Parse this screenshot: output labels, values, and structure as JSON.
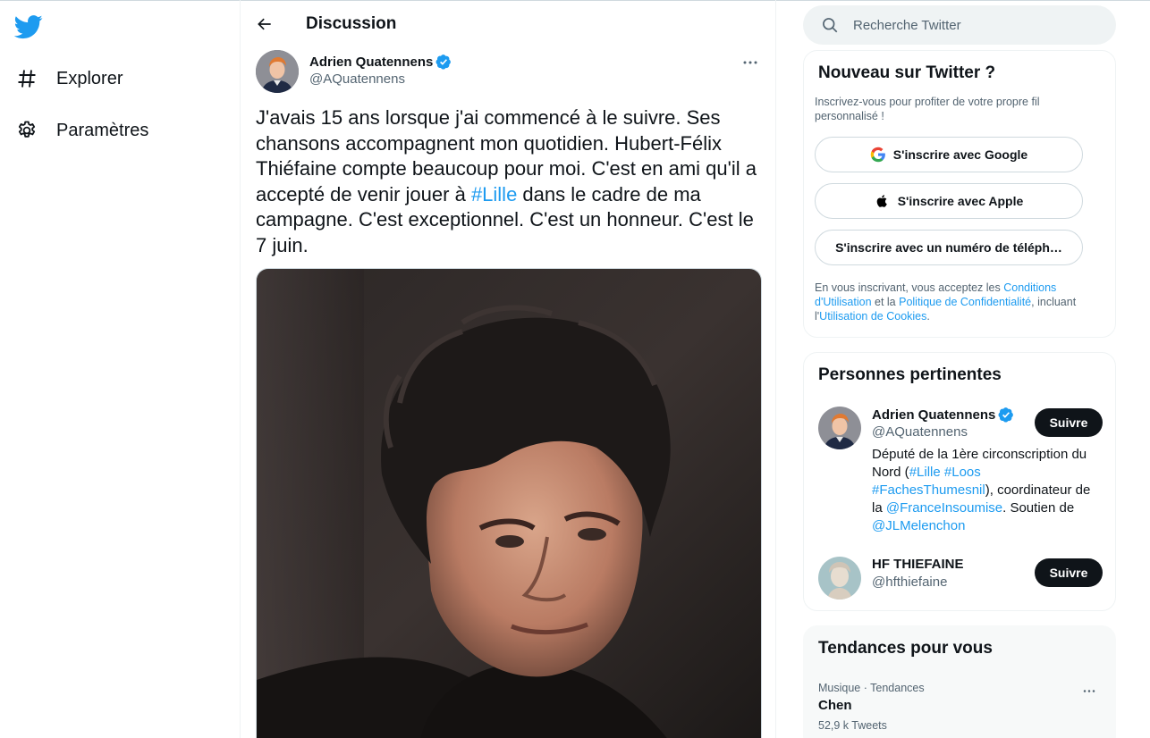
{
  "colors": {
    "brand": "#1d9bf0",
    "text": "#0f1419",
    "muted": "#536471",
    "follow_bg": "#0f1419"
  },
  "nav": {
    "logo_icon": "twitter-bird-icon",
    "items": [
      {
        "label": "Explorer",
        "icon": "hashtag-icon"
      },
      {
        "label": "Paramètres",
        "icon": "gear-icon"
      }
    ]
  },
  "header": {
    "title": "Discussion",
    "back_icon": "arrow-left-icon"
  },
  "tweet": {
    "author_name": "Adrien Quatennens",
    "author_handle": "@AQuatennens",
    "verified": true,
    "text_part1": "J'avais 15 ans lorsque j'ai commencé à le suivre. Ses chansons accompagnent mon quotidien. Hubert-Félix Thiéfaine compte beaucoup pour moi. C'est en ami qu'il a accepté de venir jouer à ",
    "hashtag": "#Lille",
    "text_part2": " dans le cadre de ma campagne. C'est exceptionnel. C'est un honneur. C'est le 7 juin."
  },
  "search": {
    "placeholder": "Recherche Twitter"
  },
  "signup": {
    "title": "Nouveau sur Twitter ?",
    "subtitle": "Inscrivez-vous pour profiter de votre propre fil personnalisé !",
    "google_label": "S'inscrire avec Google",
    "apple_label": "S'inscrire avec Apple",
    "phone_label": "S'inscrire avec un numéro de téléph…",
    "terms_part1": "En vous inscrivant, vous acceptez les ",
    "terms_link1": "Conditions d'Utilisation",
    "terms_part2": " et la ",
    "terms_link2": "Politique de Confidentialité",
    "terms_part3": ", incluant l'",
    "terms_link3": "Utilisation de Cookies",
    "terms_part4": "."
  },
  "people": {
    "title": "Personnes pertinentes",
    "list": [
      {
        "name": "Adrien Quatennens",
        "handle": "@AQuatennens",
        "verified": true,
        "follow_label": "Suivre",
        "bio": {
          "t1": "Député de la 1ère circonscription du Nord (",
          "l1": "#Lille",
          "t2": " ",
          "l2": "#Loos",
          "t3": " ",
          "l3": "#FachesThumesnil",
          "t4": "), coordinateur de la ",
          "l4": "@FranceInsoumise",
          "t5": ". Soutien de ",
          "l5": "@JLMelenchon"
        }
      },
      {
        "name": "HF THIEFAINE",
        "handle": "@hfthiefaine",
        "verified": false,
        "follow_label": "Suivre"
      }
    ]
  },
  "trends": {
    "title": "Tendances pour vous",
    "items": [
      {
        "meta": "Musique · Tendances",
        "name": "Chen",
        "count": "52,9 k Tweets"
      }
    ]
  }
}
